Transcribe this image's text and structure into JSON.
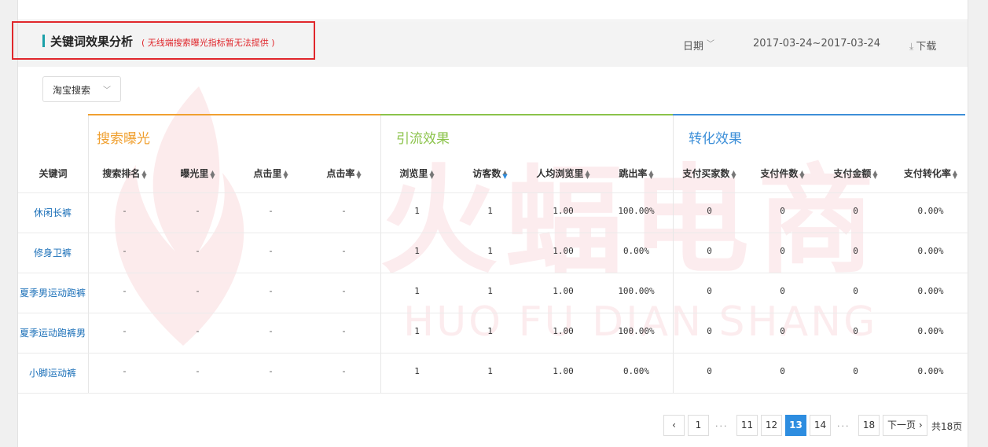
{
  "header": {
    "title": "关键词效果分析",
    "subtitle": "( 无线端搜索曝光指标暂无法提供 )",
    "date_label": "日期",
    "date_range": "2017-03-24~2017-03-24",
    "download_label": "下载"
  },
  "source_select": {
    "value": "淘宝搜索"
  },
  "watermark": {
    "cn": "火蝠电商",
    "en": "HUO FU DIAN SHANG"
  },
  "groups": [
    {
      "label": "搜索曝光",
      "color": "#f0a030"
    },
    {
      "label": "引流效果",
      "color": "#8bc34a"
    },
    {
      "label": "转化效果",
      "color": "#3d8fd8"
    }
  ],
  "columns": [
    "关键词",
    "搜索排名",
    "曝光里",
    "点击里",
    "点击率",
    "浏览里",
    "访客数",
    "人均浏览里",
    "跳出率",
    "支付买家数",
    "支付件数",
    "支付金额",
    "支付转化率"
  ],
  "rows": [
    {
      "keyword": "休闲长裤",
      "rank": "-",
      "exposure": "-",
      "clicks": "-",
      "ctr": "-",
      "pv": "1",
      "uv": "1",
      "avg_pv": "1.00",
      "bounce": "100.00%",
      "buyers": "0",
      "items": "0",
      "amount": "0",
      "conv": "0.00%"
    },
    {
      "keyword": "修身卫裤",
      "rank": "-",
      "exposure": "-",
      "clicks": "-",
      "ctr": "-",
      "pv": "1",
      "uv": "1",
      "avg_pv": "1.00",
      "bounce": "0.00%",
      "buyers": "0",
      "items": "0",
      "amount": "0",
      "conv": "0.00%"
    },
    {
      "keyword": "夏季男运动跑裤",
      "rank": "-",
      "exposure": "-",
      "clicks": "-",
      "ctr": "-",
      "pv": "1",
      "uv": "1",
      "avg_pv": "1.00",
      "bounce": "100.00%",
      "buyers": "0",
      "items": "0",
      "amount": "0",
      "conv": "0.00%"
    },
    {
      "keyword": "夏季运动跑裤男",
      "rank": "-",
      "exposure": "-",
      "clicks": "-",
      "ctr": "-",
      "pv": "1",
      "uv": "1",
      "avg_pv": "1.00",
      "bounce": "100.00%",
      "buyers": "0",
      "items": "0",
      "amount": "0",
      "conv": "0.00%"
    },
    {
      "keyword": "小脚运动裤",
      "rank": "-",
      "exposure": "-",
      "clicks": "-",
      "ctr": "-",
      "pv": "1",
      "uv": "1",
      "avg_pv": "1.00",
      "bounce": "0.00%",
      "buyers": "0",
      "items": "0",
      "amount": "0",
      "conv": "0.00%"
    }
  ],
  "pagination": {
    "prev_icon": "chevron-left-icon",
    "pages": [
      "1",
      "11",
      "12",
      "13",
      "14",
      "18"
    ],
    "dots": "...",
    "current": "13",
    "next_label": "下一页",
    "total": "共18页"
  }
}
